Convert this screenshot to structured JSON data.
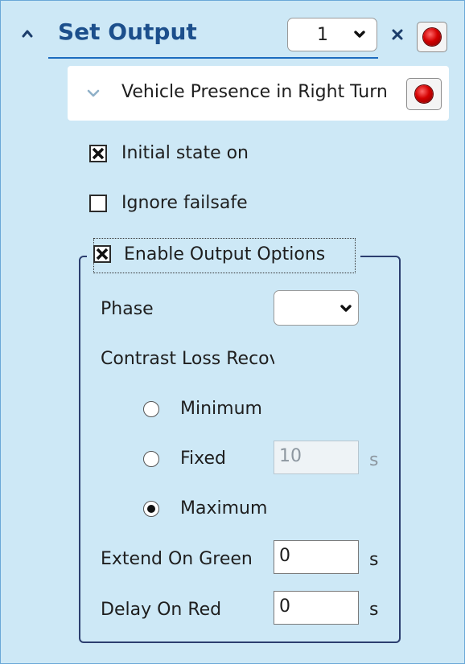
{
  "header": {
    "title": "Set Output",
    "instance_value": "1"
  },
  "sub_item": {
    "label": "Vehicle Presence in Right Turn"
  },
  "options": {
    "initial_state_label": "Initial state on",
    "initial_state_checked": true,
    "ignore_failsafe_label": "Ignore failsafe",
    "ignore_failsafe_checked": false,
    "enable_output_label": "Enable Output Options",
    "enable_output_checked": true
  },
  "output_options": {
    "phase_label": "Phase",
    "phase_value": "",
    "contrast_loss_label": "Contrast Loss Recovery",
    "radios": [
      {
        "label": "Minimum",
        "selected": false
      },
      {
        "label": "Fixed",
        "selected": false
      },
      {
        "label": "Maximum",
        "selected": true
      }
    ],
    "fixed_value": "10",
    "fixed_unit": "s",
    "extend_on_green_label": "Extend On Green",
    "extend_on_green_value": "0",
    "extend_on_green_unit": "s",
    "delay_on_red_label": "Delay On Red",
    "delay_on_red_value": "0",
    "delay_on_red_unit": "s"
  },
  "colors": {
    "background": "#cde8f6",
    "title": "#1c4f8c",
    "accent_underline": "#1c6cbf",
    "record_red": "#d40000"
  }
}
